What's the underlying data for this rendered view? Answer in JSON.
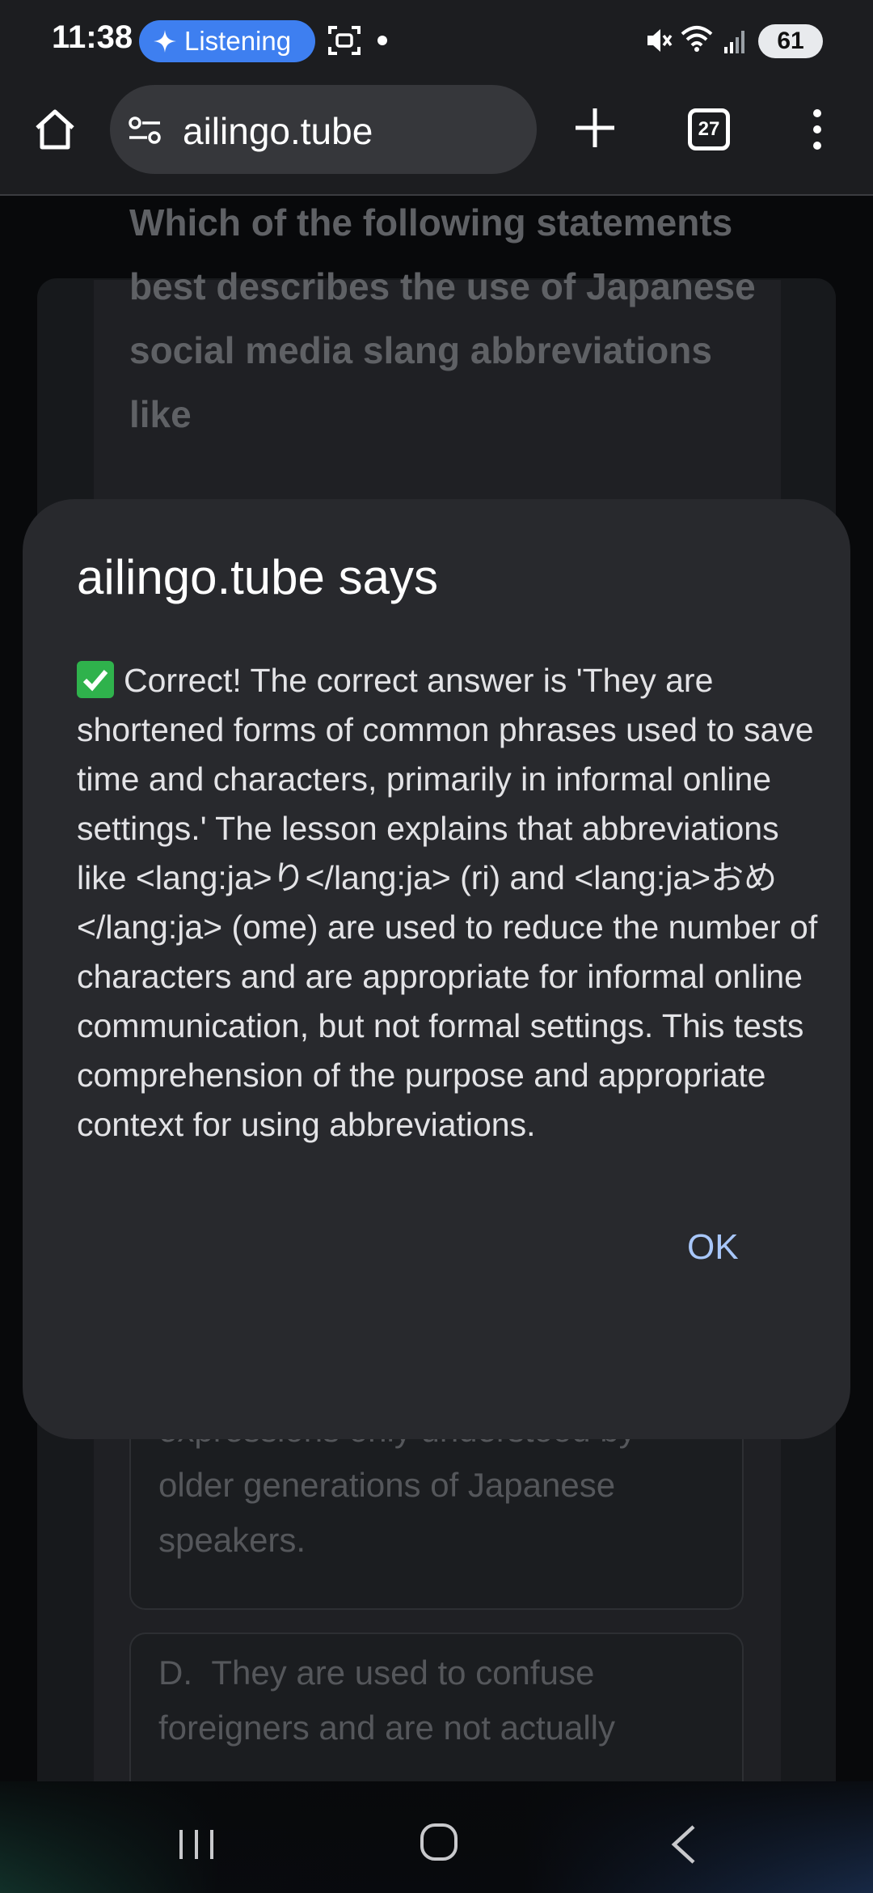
{
  "status_bar": {
    "time": "11:38",
    "listening_label": "Listening",
    "battery": "61"
  },
  "browser": {
    "url": "ailingo.tube",
    "tab_count": "27"
  },
  "page": {
    "question_text": "Which of the following statements best describes the use of Japanese social media slang abbreviations like",
    "option_c_text": "expressions only understood by older generations of Japanese speakers.",
    "option_d_letter": "D.",
    "option_d_text": "They are used to confuse foreigners and are not actually"
  },
  "dialog": {
    "title": "ailingo.tube says",
    "message": "Correct! The correct answer is 'They are shortened forms of common phrases used to save time and characters, primarily in informal online settings.' The lesson explains that abbreviations like <lang:ja>り</lang:ja> (ri) and <lang:ja>おめ</lang:ja> (ome) are used to reduce the number of characters and are appropriate for informal online communication, but not formal settings. This tests comprehension of the purpose and appropriate context for using abbreviations.",
    "ok_label": "OK"
  },
  "colors": {
    "accent": "#3e7ff0",
    "ok_text": "#a8c7fa",
    "check_green": "#2fb24c",
    "dialog_bg": "#28292d"
  },
  "icons": [
    "sparkle-icon",
    "screen-capture-icon",
    "mute-icon",
    "wifi-icon",
    "signal-icon",
    "home-icon",
    "site-settings-icon",
    "plus-icon",
    "tab-switcher-icon",
    "more-vert-icon",
    "check-icon",
    "recent-apps-icon",
    "nav-home-icon",
    "nav-back-icon"
  ]
}
